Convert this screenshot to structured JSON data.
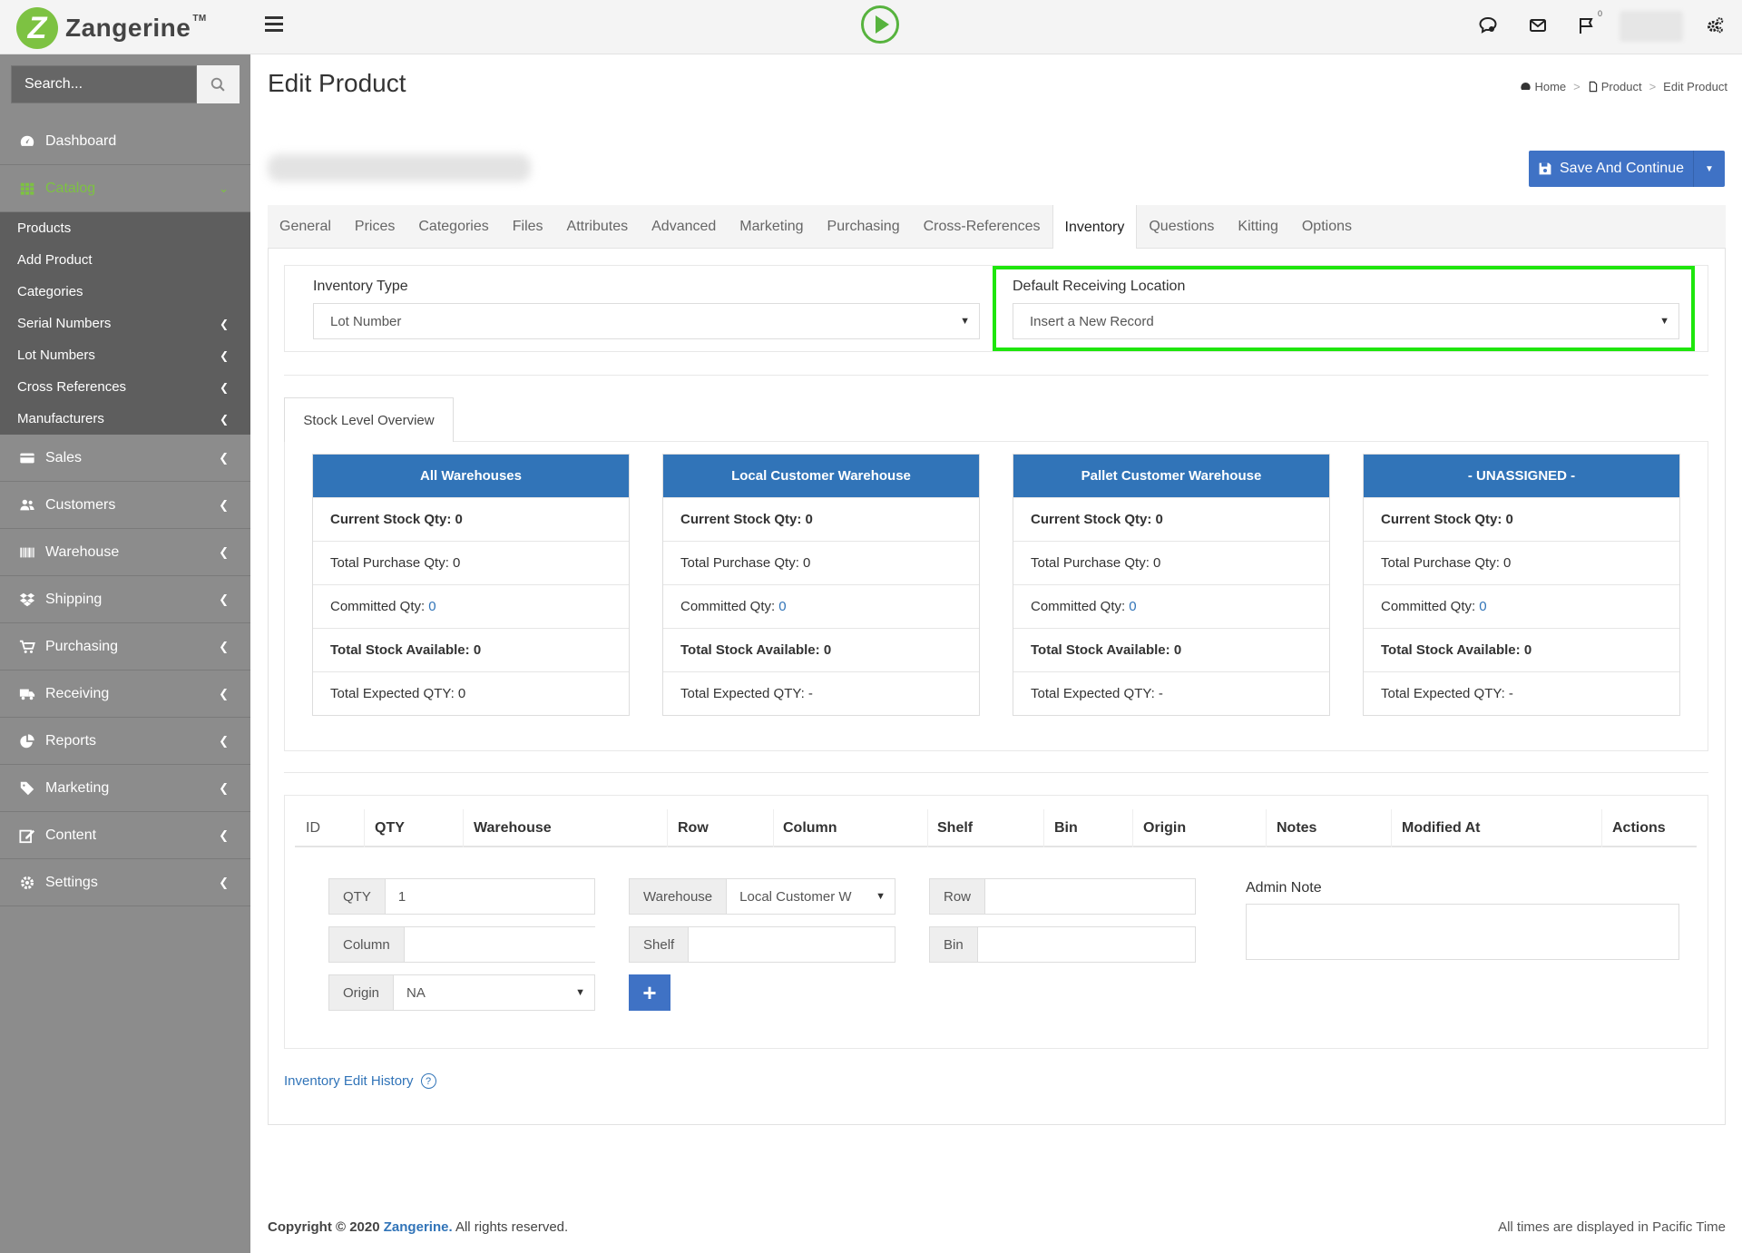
{
  "app": {
    "logo_letter": "Z",
    "brand_name": "Zangerine",
    "brand_tm": "TM",
    "notifications_count": "0"
  },
  "search": {
    "placeholder": "Search..."
  },
  "sidebar": {
    "items": [
      {
        "label": "Dashboard",
        "icon": "dashboard-icon"
      },
      {
        "label": "Catalog",
        "icon": "grid-icon"
      }
    ],
    "catalog_sub": [
      {
        "label": "Products"
      },
      {
        "label": "Add Product"
      },
      {
        "label": "Categories"
      },
      {
        "label": "Serial Numbers"
      },
      {
        "label": "Lot Numbers"
      },
      {
        "label": "Cross References"
      },
      {
        "label": "Manufacturers"
      }
    ],
    "more": [
      {
        "label": "Sales"
      },
      {
        "label": "Customers"
      },
      {
        "label": "Warehouse"
      },
      {
        "label": "Shipping"
      },
      {
        "label": "Purchasing"
      },
      {
        "label": "Receiving"
      },
      {
        "label": "Reports"
      },
      {
        "label": "Marketing"
      },
      {
        "label": "Content"
      },
      {
        "label": "Settings"
      }
    ]
  },
  "page": {
    "title": "Edit Product"
  },
  "breadcrumb": {
    "home": "Home",
    "product": "Product",
    "current": "Edit Product",
    "sep": ">"
  },
  "save_button": {
    "label": "Save And Continue"
  },
  "tabs": [
    "General",
    "Prices",
    "Categories",
    "Files",
    "Attributes",
    "Advanced",
    "Marketing",
    "Purchasing",
    "Cross-References",
    "Inventory",
    "Questions",
    "Kitting",
    "Options"
  ],
  "inventory": {
    "type_label": "Inventory Type",
    "type_value": "Lot Number",
    "receiving_label": "Default Receiving Location",
    "receiving_value": "Insert a New Record"
  },
  "stock_tab": "Stock Level Overview",
  "warehouses": [
    {
      "name": "All Warehouses",
      "current": "Current Stock Qty: 0",
      "purchase": "Total Purchase Qty: 0",
      "committed_label": "Committed Qty:",
      "committed_value": "0",
      "available": "Total Stock Available: 0",
      "expected": "Total Expected QTY: 0"
    },
    {
      "name": "Local Customer Warehouse",
      "current": "Current Stock Qty: 0",
      "purchase": "Total Purchase Qty: 0",
      "committed_label": "Committed Qty:",
      "committed_value": "0",
      "available": "Total Stock Available: 0",
      "expected": "Total Expected QTY: -"
    },
    {
      "name": "Pallet Customer Warehouse",
      "current": "Current Stock Qty: 0",
      "purchase": "Total Purchase Qty: 0",
      "committed_label": "Committed Qty:",
      "committed_value": "0",
      "available": "Total Stock Available: 0",
      "expected": "Total Expected QTY: -"
    },
    {
      "name": "- UNASSIGNED -",
      "current": "Current Stock Qty: 0",
      "purchase": "Total Purchase Qty: 0",
      "committed_label": "Committed Qty:",
      "committed_value": "0",
      "available": "Total Stock Available: 0",
      "expected": "Total Expected QTY: -"
    }
  ],
  "table": {
    "columns": [
      "ID",
      "QTY",
      "Warehouse",
      "Row",
      "Column",
      "Shelf",
      "Bin",
      "Origin",
      "Notes",
      "Modified At",
      "Actions"
    ]
  },
  "form": {
    "qty_label": "QTY",
    "qty_value": "1",
    "warehouse_label": "Warehouse",
    "warehouse_value": "Local Customer W",
    "row_label": "Row",
    "column_label": "Column",
    "shelf_label": "Shelf",
    "bin_label": "Bin",
    "origin_label": "Origin",
    "origin_value": "NA",
    "add_label": "+",
    "admin_note_label": "Admin Note"
  },
  "history_link": "Inventory Edit History",
  "footer": {
    "copyright_prefix": "Copyright © 2020",
    "brand": "Zangerine.",
    "suffix": "All rights reserved.",
    "timezone": "All times are displayed in Pacific Time"
  }
}
